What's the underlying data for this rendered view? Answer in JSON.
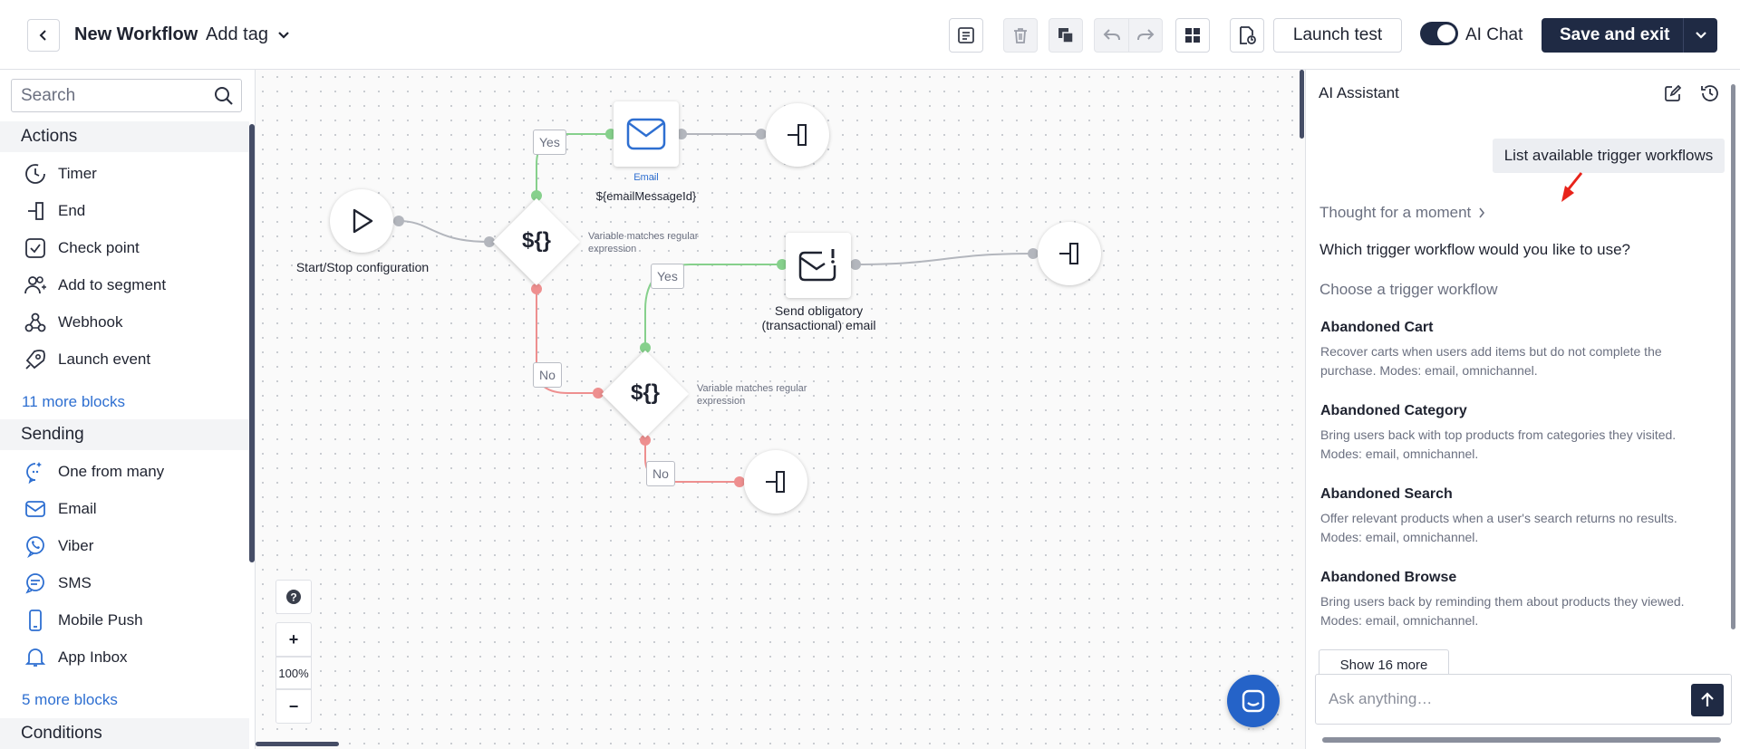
{
  "header": {
    "title": "New Workflow",
    "add_tag": "Add tag",
    "launch_test": "Launch test",
    "ai_chat": "AI Chat",
    "save_exit": "Save and exit"
  },
  "sidebar": {
    "search_placeholder": "Search",
    "actions_title": "Actions",
    "actions": [
      "Timer",
      "End",
      "Check point",
      "Add to segment",
      "Webhook",
      "Launch event"
    ],
    "actions_more": "11 more blocks",
    "sending_title": "Sending",
    "sending": [
      "One from many",
      "Email",
      "Viber",
      "SMS",
      "Mobile Push",
      "App Inbox"
    ],
    "sending_more": "5 more blocks",
    "conditions_title": "Conditions"
  },
  "canvas": {
    "start_label": "Start/Stop configuration",
    "email_type": "Email",
    "email_label": "${emailMessageId}",
    "condition_symbol": "${}",
    "condition_note": "Variable matches regular expression",
    "transactional_label": "Send obligatory (transactional) email",
    "yes": "Yes",
    "no": "No",
    "zoom_level": "100%",
    "zoom_in": "+",
    "zoom_out": "−"
  },
  "ai_panel": {
    "title": "AI Assistant",
    "user_message": "List available trigger workflows",
    "thought": "Thought for a moment",
    "question": "Which trigger workflow would you like to use?",
    "choose": "Choose a trigger workflow",
    "workflows": [
      {
        "title": "Abandoned Cart",
        "desc": "Recover carts when users add items but do not complete the purchase. Modes: email, omnichannel."
      },
      {
        "title": "Abandoned Category",
        "desc": "Bring users back with top products from categories they visited. Modes: email, omnichannel."
      },
      {
        "title": "Abandoned Search",
        "desc": "Offer relevant products when a user's search returns no results. Modes: email, omnichannel."
      },
      {
        "title": "Abandoned Browse",
        "desc": "Bring users back by reminding them about products they viewed. Modes: email, omnichannel."
      }
    ],
    "show_more": "Show 16 more",
    "ask_placeholder": "Ask anything…"
  },
  "colors": {
    "primary": "#1f2a44",
    "link": "#2e6fd1",
    "yes_line": "#86d08c",
    "no_line": "#ee8f8f",
    "neutral_line": "#b3b6bd",
    "annotation_arrow": "#e8231a"
  }
}
